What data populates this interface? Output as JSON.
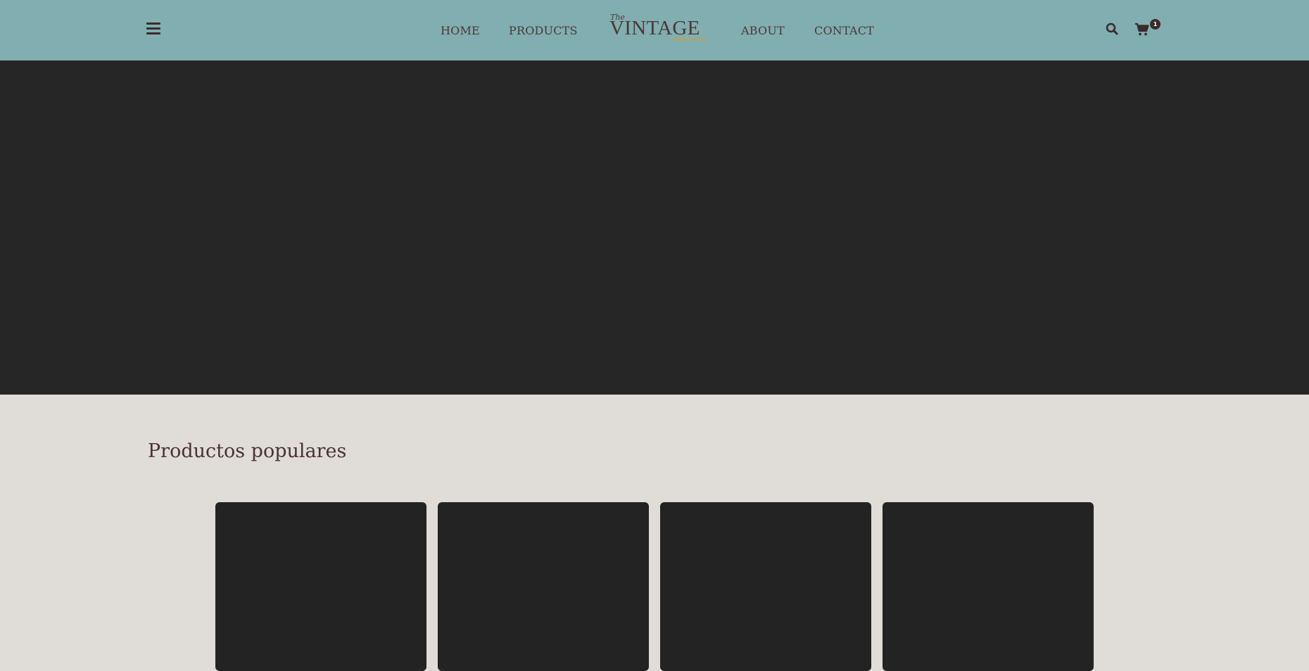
{
  "header": {
    "background": "#81aeb0",
    "nav_left": [
      {
        "label": "HOME"
      },
      {
        "label": "PRODUCTS"
      }
    ],
    "nav_right": [
      {
        "label": "ABOUT"
      },
      {
        "label": "CONTACT"
      }
    ],
    "logo": {
      "the": "The",
      "main": "VINTAGE",
      "sub": "collection"
    },
    "menu_icon": "hamburger-icon",
    "search_icon": "search-icon",
    "cart_icon": "cart-icon",
    "cart_count": "1"
  },
  "hero": {
    "background": "#262626"
  },
  "popular": {
    "title": "Productos populares",
    "cards": [
      {
        "id": "card-1"
      },
      {
        "id": "card-2"
      },
      {
        "id": "card-3"
      },
      {
        "id": "card-4"
      }
    ]
  },
  "colors": {
    "page_background": "#e0ddd8",
    "text": "#4a3838",
    "accent_gold": "#c9a13a",
    "card": "#232323"
  }
}
